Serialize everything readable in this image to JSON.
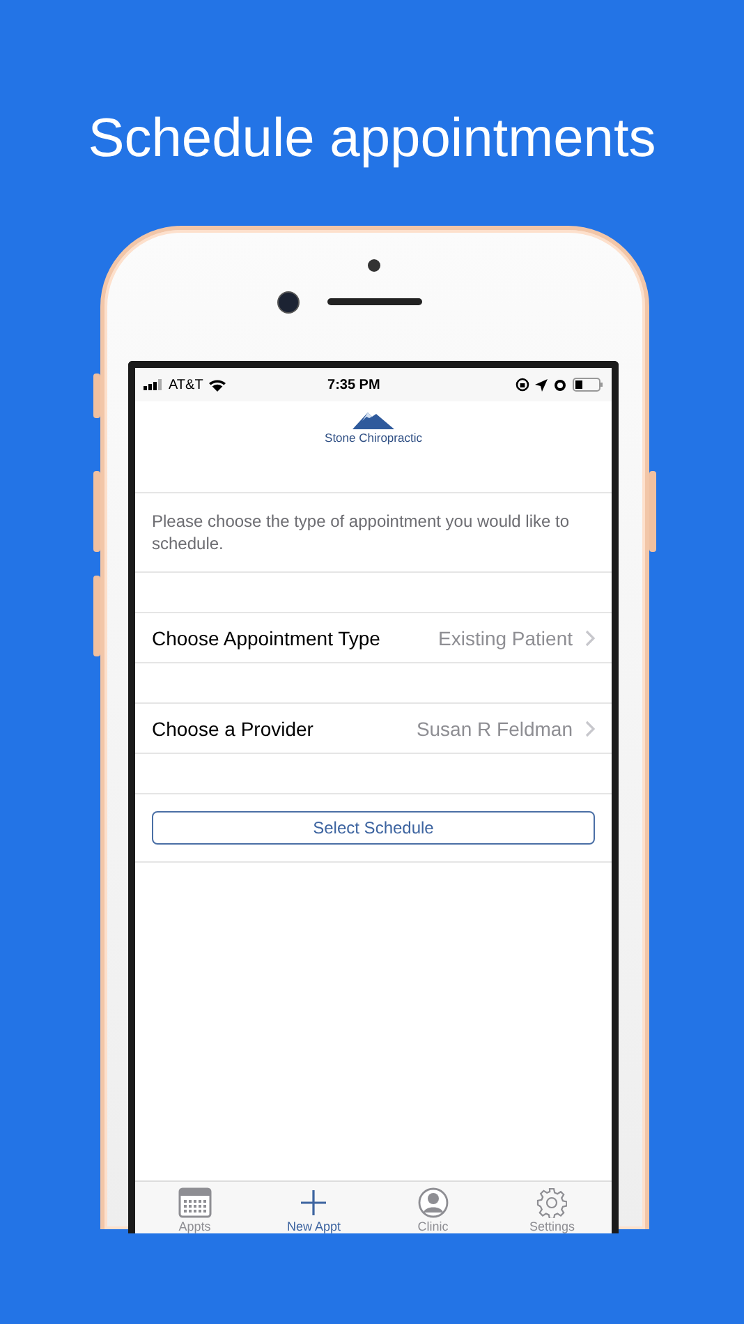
{
  "headline": "Schedule appointments",
  "status_bar": {
    "carrier": "AT&T",
    "time": "7:35 PM"
  },
  "clinic_name": "Stone Chiropractic",
  "instructions": "Please choose the type of appointment you would like to schedule.",
  "rows": [
    {
      "label": "Choose Appointment Type",
      "value": "Existing Patient"
    },
    {
      "label": "Choose a Provider",
      "value": "Susan R Feldman"
    }
  ],
  "button": "Select Schedule",
  "tabs": [
    {
      "label": "Appts",
      "kind": "calendar",
      "selected": false
    },
    {
      "label": "New Appt",
      "kind": "plus",
      "selected": true
    },
    {
      "label": "Clinic",
      "kind": "person",
      "selected": false
    },
    {
      "label": "Settings",
      "kind": "gear",
      "selected": false
    }
  ]
}
